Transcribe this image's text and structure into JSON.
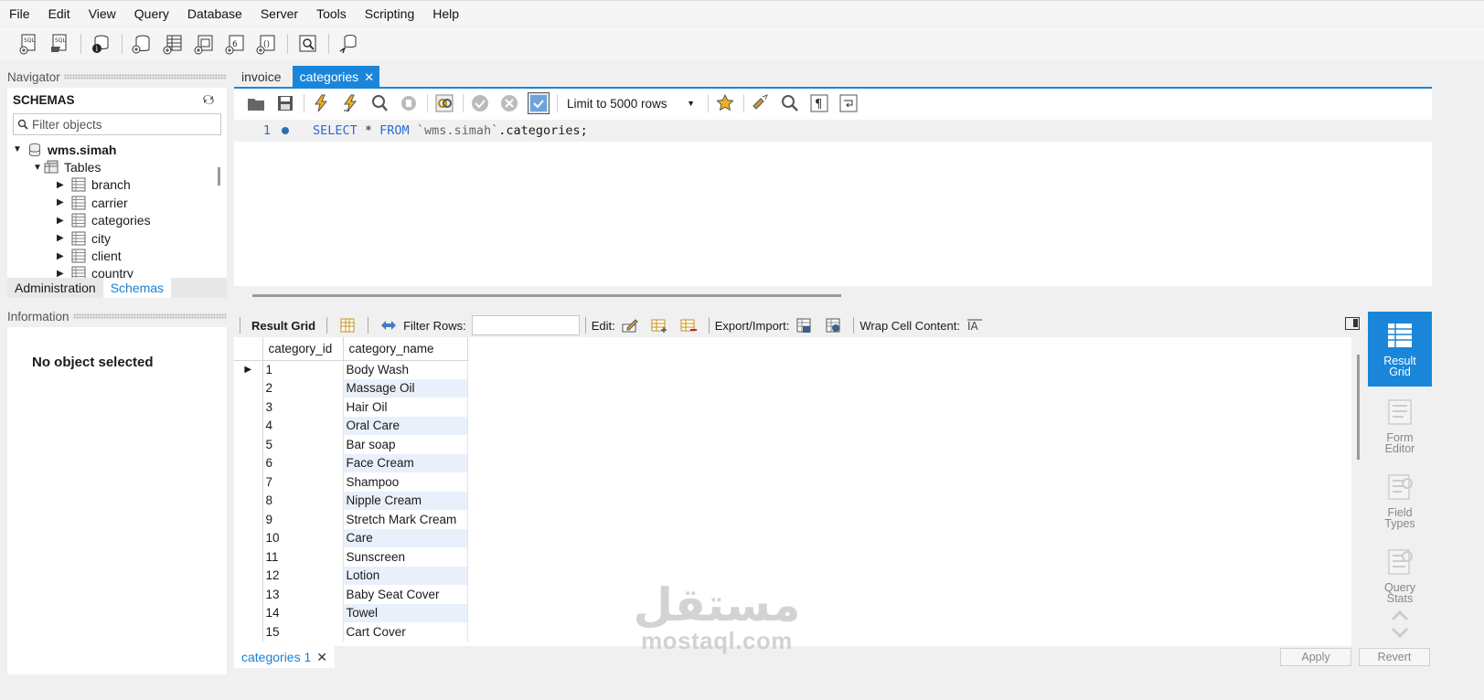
{
  "menu": [
    "File",
    "Edit",
    "View",
    "Query",
    "Database",
    "Server",
    "Tools",
    "Scripting",
    "Help"
  ],
  "toolbar_icons": [
    "new-sql-tab-icon",
    "open-sql-script-icon",
    "schema-inspector-icon",
    "create-schema-icon",
    "create-table-icon",
    "create-view-icon",
    "create-procedure-icon",
    "create-function-icon",
    "search-table-data-icon",
    "reconnect-icon"
  ],
  "navigator": {
    "header": "Navigator",
    "schemas_title": "SCHEMAS",
    "filter_placeholder": "Filter objects",
    "schema": "wms.simah",
    "tables_label": "Tables",
    "tables": [
      "branch",
      "carrier",
      "categories",
      "city",
      "client",
      "country"
    ],
    "tabs": [
      "Administration",
      "Schemas"
    ]
  },
  "information": {
    "header": "Information",
    "message": "No object selected"
  },
  "editor": {
    "tabs": [
      "invoice",
      "categories"
    ],
    "limit": "Limit to 5000 rows",
    "line_number": "1",
    "code": {
      "kw1": "SELECT",
      "star": " * ",
      "kw2": "FROM",
      "schema": " `wms.simah`",
      "rest": ".categories;"
    }
  },
  "result": {
    "result_grid_label": "Result Grid",
    "filter_rows_label": "Filter Rows:",
    "edit_label": "Edit:",
    "export_label": "Export/Import:",
    "wrap_label": "Wrap Cell Content:",
    "columns": [
      "category_id",
      "category_name"
    ],
    "rows": [
      [
        "1",
        "Body Wash"
      ],
      [
        "2",
        "Massage Oil"
      ],
      [
        "3",
        "Hair Oil"
      ],
      [
        "4",
        "Oral Care"
      ],
      [
        "5",
        "Bar soap"
      ],
      [
        "6",
        "Face Cream"
      ],
      [
        "7",
        "Shampoo"
      ],
      [
        "8",
        "Nipple Cream"
      ],
      [
        "9",
        "Stretch Mark Cream"
      ],
      [
        "10",
        "Care"
      ],
      [
        "11",
        "Sunscreen"
      ],
      [
        "12",
        "Lotion"
      ],
      [
        "13",
        "Baby Seat Cover"
      ],
      [
        "14",
        "Towel"
      ],
      [
        "15",
        "Cart Cover"
      ]
    ],
    "bottom_tab": "categories 1",
    "apply": "Apply",
    "revert": "Revert"
  },
  "side_panel": [
    {
      "line1": "Result",
      "line2": "Grid",
      "icon": "result-grid-icon",
      "active": true
    },
    {
      "line1": "Form",
      "line2": "Editor",
      "icon": "form-editor-icon",
      "active": false
    },
    {
      "line1": "Field",
      "line2": "Types",
      "icon": "field-types-icon",
      "active": false
    },
    {
      "line1": "Query",
      "line2": "Stats",
      "icon": "query-stats-icon",
      "active": false
    }
  ],
  "watermark": {
    "arabic": "مستقل",
    "latin": "mostaql.com"
  }
}
